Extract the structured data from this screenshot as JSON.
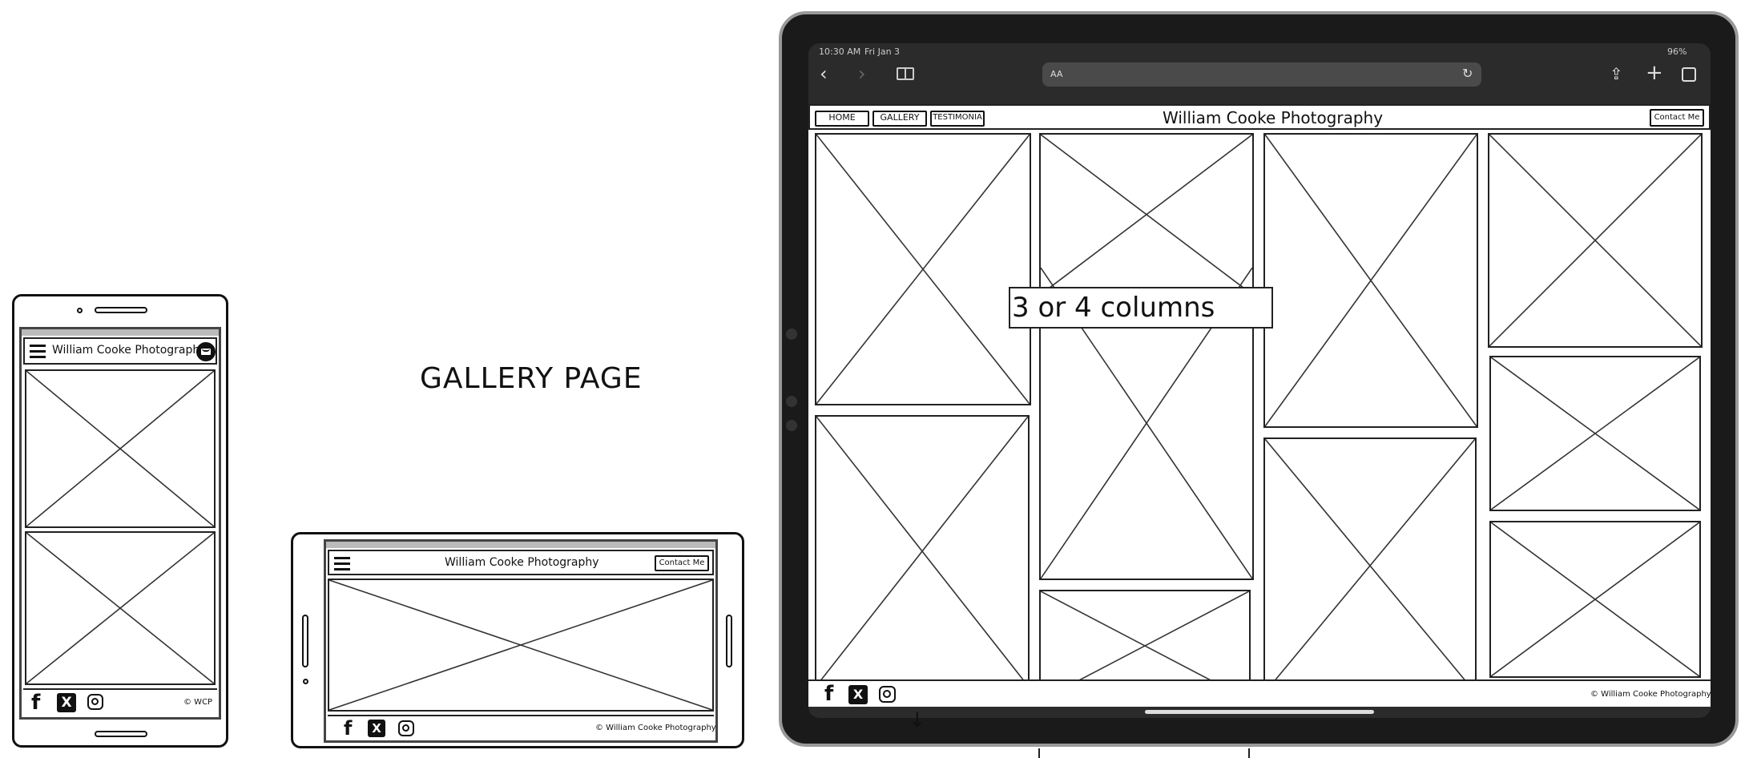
{
  "page_label": "GALLERY PAGE",
  "site_title": "William Cooke Photography",
  "nav": {
    "home": "HOME",
    "gallery": "GALLERY",
    "testimonials": "TESTIMONIA"
  },
  "contact_button": "Contact Me",
  "footer": {
    "copyright_full": "© William Cooke Photography",
    "copyright_short": "© WCP"
  },
  "tablet": {
    "status_time": "10:30 AM",
    "status_date": "Fri Jan 3",
    "battery": "96%",
    "address_bar": "AA",
    "annotation": "3 or 4 columns"
  },
  "icons": [
    "facebook-icon",
    "x-icon",
    "instagram-icon",
    "hamburger-icon",
    "mail-icon"
  ]
}
